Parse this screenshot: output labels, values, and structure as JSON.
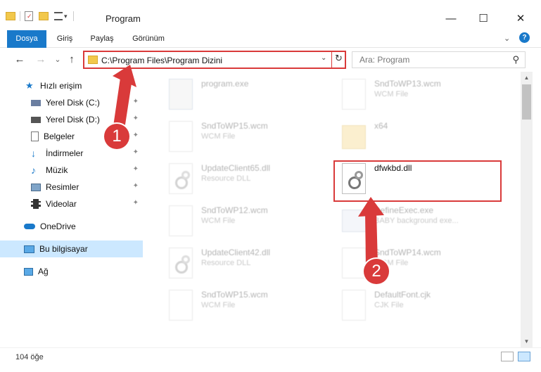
{
  "window": {
    "title": "Program",
    "controls": {
      "minimize": "—",
      "maximize": "☐",
      "close": "✕"
    }
  },
  "ribbon": {
    "tabs": [
      "Dosya",
      "Giriş",
      "Paylaş",
      "Görünüm"
    ],
    "expand_icon": "chevron-down-icon",
    "help_icon": "help-icon"
  },
  "nav": {
    "back": "←",
    "forward": "→",
    "recent": "⌄",
    "up": "↑",
    "address": "C:\\Program Files\\Program Dizini",
    "address_dropdown": "⌄",
    "refresh": "↻",
    "search_placeholder": "Ara: Program",
    "search_glyph": "⚲"
  },
  "sidebar": {
    "items": [
      {
        "label": "Hızlı erişim",
        "icon": "star-icon",
        "pinned": false
      },
      {
        "label": "Yerel Disk (C:)",
        "icon": "drive-icon",
        "pinned": true
      },
      {
        "label": "Yerel Disk (D:)",
        "icon": "drive-icon",
        "pinned": true
      },
      {
        "label": "Belgeler",
        "icon": "documents-icon",
        "pinned": true
      },
      {
        "label": "İndirmeler",
        "icon": "download-icon",
        "pinned": true
      },
      {
        "label": "Müzik",
        "icon": "music-icon",
        "pinned": true
      },
      {
        "label": "Resimler",
        "icon": "pictures-icon",
        "pinned": true
      },
      {
        "label": "Videolar",
        "icon": "videos-icon",
        "pinned": true
      },
      {
        "label": "OneDrive",
        "icon": "cloud-icon",
        "pinned": false
      },
      {
        "label": "Bu bilgisayar",
        "icon": "computer-icon",
        "pinned": false,
        "selected": true
      },
      {
        "label": "Ağ",
        "icon": "network-icon",
        "pinned": false
      }
    ],
    "pin_glyph": "📌"
  },
  "files": [
    {
      "name": "program.exe",
      "type": "",
      "icon": "exe-icon"
    },
    {
      "name": "SndToWP13.wcm",
      "type": "WCM File",
      "icon": "file-icon"
    },
    {
      "name": "SndToWP15.wcm",
      "type": "WCM File",
      "icon": "file-icon"
    },
    {
      "name": "x64",
      "type": "",
      "icon": "folder-icon"
    },
    {
      "name": "UpdateClient65.dll",
      "type": "Resource DLL",
      "icon": "dll-icon"
    },
    {
      "name": "dfwkbd.dll",
      "type": "",
      "icon": "dll-icon"
    },
    {
      "name": "SndToWP12.wcm",
      "type": "WCM File",
      "icon": "file-icon"
    },
    {
      "name": "DefineExec.exe",
      "type": "BABY background exe...",
      "icon": "exe-icon"
    },
    {
      "name": "UpdateClient42.dll",
      "type": "Resource DLL",
      "icon": "dll-icon"
    },
    {
      "name": "SndToWP14.wcm",
      "type": "WCM File",
      "icon": "file-icon"
    },
    {
      "name": "SndToWP15.wcm",
      "type": "WCM File",
      "icon": "file-icon"
    },
    {
      "name": "DefaultFont.cjk",
      "type": "CJK File",
      "icon": "file-icon"
    }
  ],
  "status": {
    "count": "104 öğe"
  },
  "annotations": {
    "step1": "1",
    "step2": "2"
  },
  "colors": {
    "accent": "#1979ca",
    "highlight": "#d93a3a",
    "selected": "#cce8ff"
  }
}
